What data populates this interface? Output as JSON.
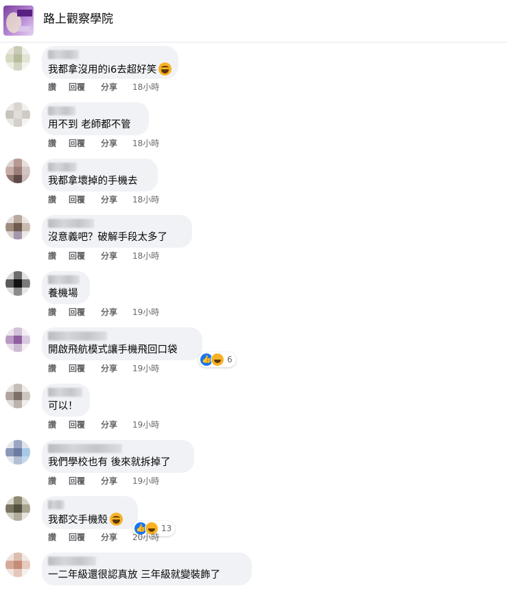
{
  "page": {
    "title": "路上觀察學院"
  },
  "actions": {
    "like": "讚",
    "reply": "回覆",
    "share": "分享"
  },
  "comments": [
    {
      "text": "我都拿沒用的i6去超好笑",
      "time": "18小時",
      "emoji": true,
      "reactions": null
    },
    {
      "text": "用不到 老師都不管",
      "time": "18小時",
      "emoji": false,
      "reactions": null
    },
    {
      "text": "我都拿壞掉的手機去",
      "time": "18小時",
      "emoji": false,
      "reactions": null
    },
    {
      "text": "沒意義吧？破解手段太多了",
      "time": "18小時",
      "emoji": false,
      "reactions": null
    },
    {
      "text": "養機場",
      "time": "19小時",
      "emoji": false,
      "reactions": null
    },
    {
      "text": "開啟飛航模式讓手機飛回口袋",
      "time": "19小時",
      "emoji": false,
      "reactions": "6"
    },
    {
      "text": "可以！",
      "time": "19小時",
      "emoji": false,
      "reactions": null
    },
    {
      "text": "我們學校也有 後來就拆掉了",
      "time": "19小時",
      "emoji": false,
      "reactions": null
    },
    {
      "text": "我都交手機殼",
      "time": "20小時",
      "emoji": true,
      "reactions": "13"
    },
    {
      "text": "一二年級還很認真放 三年級就變裝飾了",
      "time": "",
      "emoji": false,
      "reactions": null
    }
  ],
  "colors": {
    "bubble": "#f0f2f5",
    "meta": "#65676b",
    "like": "#1877f2",
    "haha": "#f7b125"
  }
}
